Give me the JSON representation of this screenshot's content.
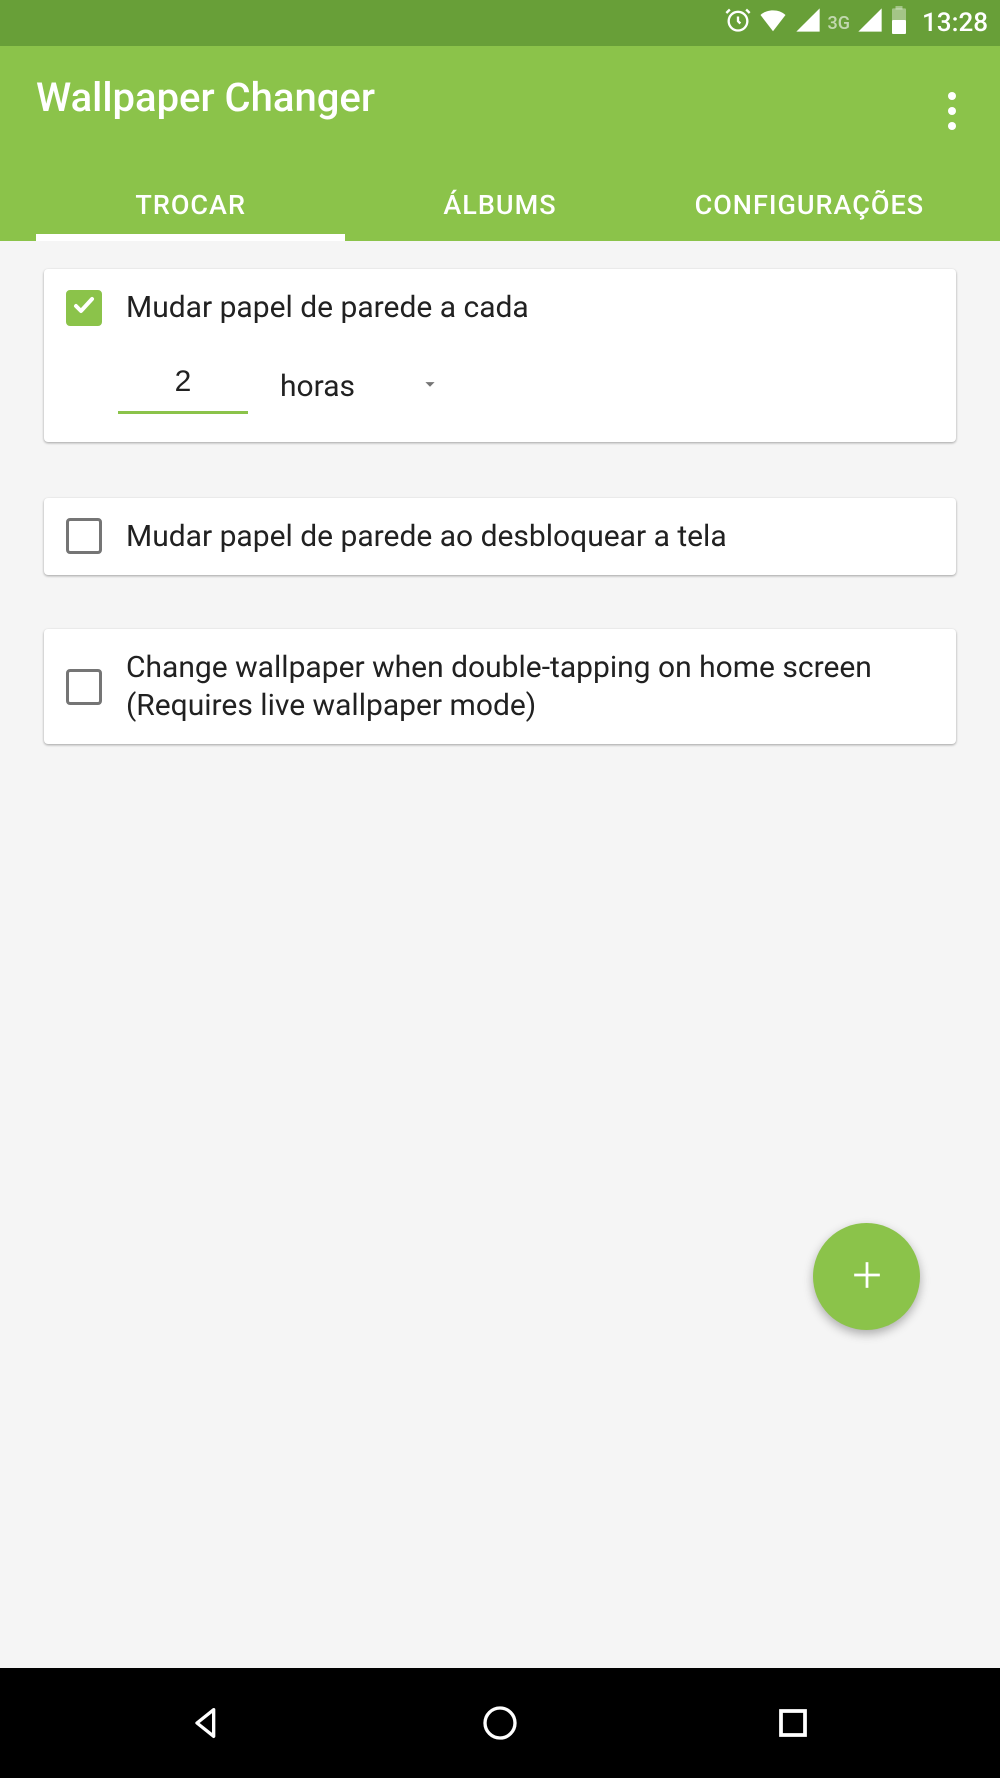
{
  "status_bar": {
    "time": "13:28",
    "network_label": "3G"
  },
  "header": {
    "title": "Wallpaper Changer"
  },
  "tabs": {
    "items": [
      {
        "label": "TROCAR",
        "active": true
      },
      {
        "label": "ÁLBUMS",
        "active": false
      },
      {
        "label": "CONFIGURAÇÕES",
        "active": false
      }
    ]
  },
  "cards": {
    "change_every": {
      "checked": true,
      "label": "Mudar papel de parede a cada",
      "interval_value": "2",
      "interval_unit": "horas"
    },
    "change_on_unlock": {
      "checked": false,
      "label": "Mudar papel de parede ao desbloquear a tela"
    },
    "change_on_doubletap": {
      "checked": false,
      "label": "Change wallpaper when double-tapping on home screen (Requires live wallpaper mode)"
    }
  },
  "colors": {
    "primary": "#8bc34a",
    "primary_dark": "#689f38",
    "background": "#f5f5f5"
  }
}
